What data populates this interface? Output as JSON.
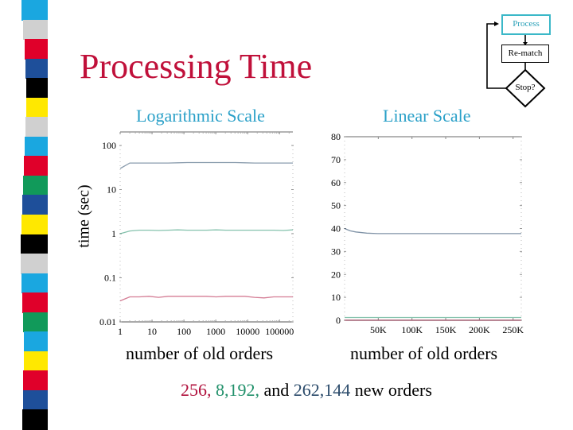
{
  "decor": {
    "stripes": [
      {
        "color": "#1aa7e0"
      },
      {
        "color": "#d0d0d0"
      },
      {
        "color": "#e0002a"
      },
      {
        "color": "#1e4f9a"
      },
      {
        "color": "#000000"
      },
      {
        "color": "#ffe800"
      },
      {
        "color": "#d0d0d0"
      },
      {
        "color": "#1aa7e0"
      },
      {
        "color": "#e0002a"
      },
      {
        "color": "#119a5a"
      },
      {
        "color": "#1e4f9a"
      },
      {
        "color": "#ffe800"
      },
      {
        "color": "#000000"
      },
      {
        "color": "#d0d0d0"
      },
      {
        "color": "#1aa7e0"
      },
      {
        "color": "#e0002a"
      },
      {
        "color": "#119a5a"
      },
      {
        "color": "#1aa7e0"
      },
      {
        "color": "#ffe800"
      },
      {
        "color": "#e0002a"
      },
      {
        "color": "#1e4f9a"
      },
      {
        "color": "#000000"
      }
    ]
  },
  "header": {
    "title": "Processing Time"
  },
  "flowchart": {
    "process": "Process",
    "rematch": "Re-match",
    "stop": "Stop?"
  },
  "colors": {
    "title": "#c0103a",
    "subtitle": "#2aa0c8",
    "series_256": "#b0103c",
    "series_8192": "#20906a",
    "series_262144": "#2a4a6a"
  },
  "footer": {
    "part1": "256,",
    "part2": "8,192,",
    "part3": "and",
    "part4": "262,144",
    "part5": "new orders"
  },
  "chart_data": [
    {
      "type": "line",
      "title": "Logarithmic Scale",
      "xlabel": "number of old orders",
      "ylabel": "time (sec)",
      "xscale": "log",
      "yscale": "log",
      "xlim": [
        1,
        262144
      ],
      "ylim": [
        0.01,
        100
      ],
      "xticks": [
        1,
        10,
        100,
        1000,
        10000,
        100000
      ],
      "xtick_labels": [
        "1",
        "10",
        "100",
        "1000",
        "10000",
        "100000"
      ],
      "yticks": [
        0.01,
        0.1,
        1,
        10,
        100
      ],
      "ytick_labels": [
        "0.01",
        "0.1",
        "1",
        "10",
        "100"
      ],
      "grid": false,
      "x": [
        1,
        2,
        4,
        8,
        16,
        32,
        64,
        128,
        256,
        512,
        1024,
        2048,
        4096,
        8192,
        16384,
        32768,
        65536,
        131072,
        262144
      ],
      "series": [
        {
          "name": "262,144 new orders",
          "color": "#2a4a6a",
          "values": [
            30,
            40,
            40,
            40,
            40,
            40,
            40.5,
            41,
            41,
            41,
            41,
            41,
            41,
            40.5,
            40,
            40,
            40,
            40,
            40
          ]
        },
        {
          "name": "8,192 new orders",
          "color": "#20906a",
          "values": [
            1.0,
            1.15,
            1.2,
            1.2,
            1.18,
            1.2,
            1.22,
            1.2,
            1.2,
            1.2,
            1.22,
            1.2,
            1.2,
            1.2,
            1.2,
            1.2,
            1.2,
            1.18,
            1.22
          ]
        },
        {
          "name": "256 new orders",
          "color": "#b0103c",
          "values": [
            0.03,
            0.037,
            0.037,
            0.038,
            0.036,
            0.038,
            0.038,
            0.038,
            0.038,
            0.038,
            0.037,
            0.038,
            0.038,
            0.038,
            0.036,
            0.035,
            0.037,
            0.037,
            0.037
          ]
        }
      ]
    },
    {
      "type": "line",
      "title": "Linear Scale",
      "xlabel": "number of old orders",
      "ylabel": "time (sec)",
      "xscale": "linear",
      "yscale": "linear",
      "xlim": [
        0,
        262144
      ],
      "ylim": [
        0,
        80
      ],
      "xticks": [
        50000,
        100000,
        150000,
        200000,
        250000
      ],
      "xtick_labels": [
        "50K",
        "100K",
        "150K",
        "200K",
        "250K"
      ],
      "yticks": [
        0,
        10,
        20,
        30,
        40,
        50,
        60,
        70,
        80
      ],
      "ytick_labels": [
        "0",
        "10",
        "20",
        "30",
        "40",
        "50",
        "60",
        "70",
        "80"
      ],
      "grid": false,
      "x": [
        0,
        8192,
        16384,
        32768,
        49152,
        65536,
        98304,
        131072,
        163840,
        196608,
        229376,
        262144
      ],
      "series": [
        {
          "name": "262,144 new orders",
          "color": "#2a4a6a",
          "values": [
            40,
            39,
            38.5,
            38,
            37.8,
            37.8,
            37.8,
            37.8,
            37.8,
            37.8,
            37.8,
            37.8
          ]
        },
        {
          "name": "8,192 new orders",
          "color": "#20906a",
          "values": [
            1.2,
            1.2,
            1.2,
            1.2,
            1.2,
            1.2,
            1.2,
            1.2,
            1.2,
            1.2,
            1.2,
            1.2
          ]
        },
        {
          "name": "256 new orders",
          "color": "#b0103c",
          "values": [
            0.04,
            0.04,
            0.04,
            0.04,
            0.04,
            0.04,
            0.04,
            0.04,
            0.04,
            0.04,
            0.04,
            0.04
          ]
        }
      ]
    }
  ]
}
